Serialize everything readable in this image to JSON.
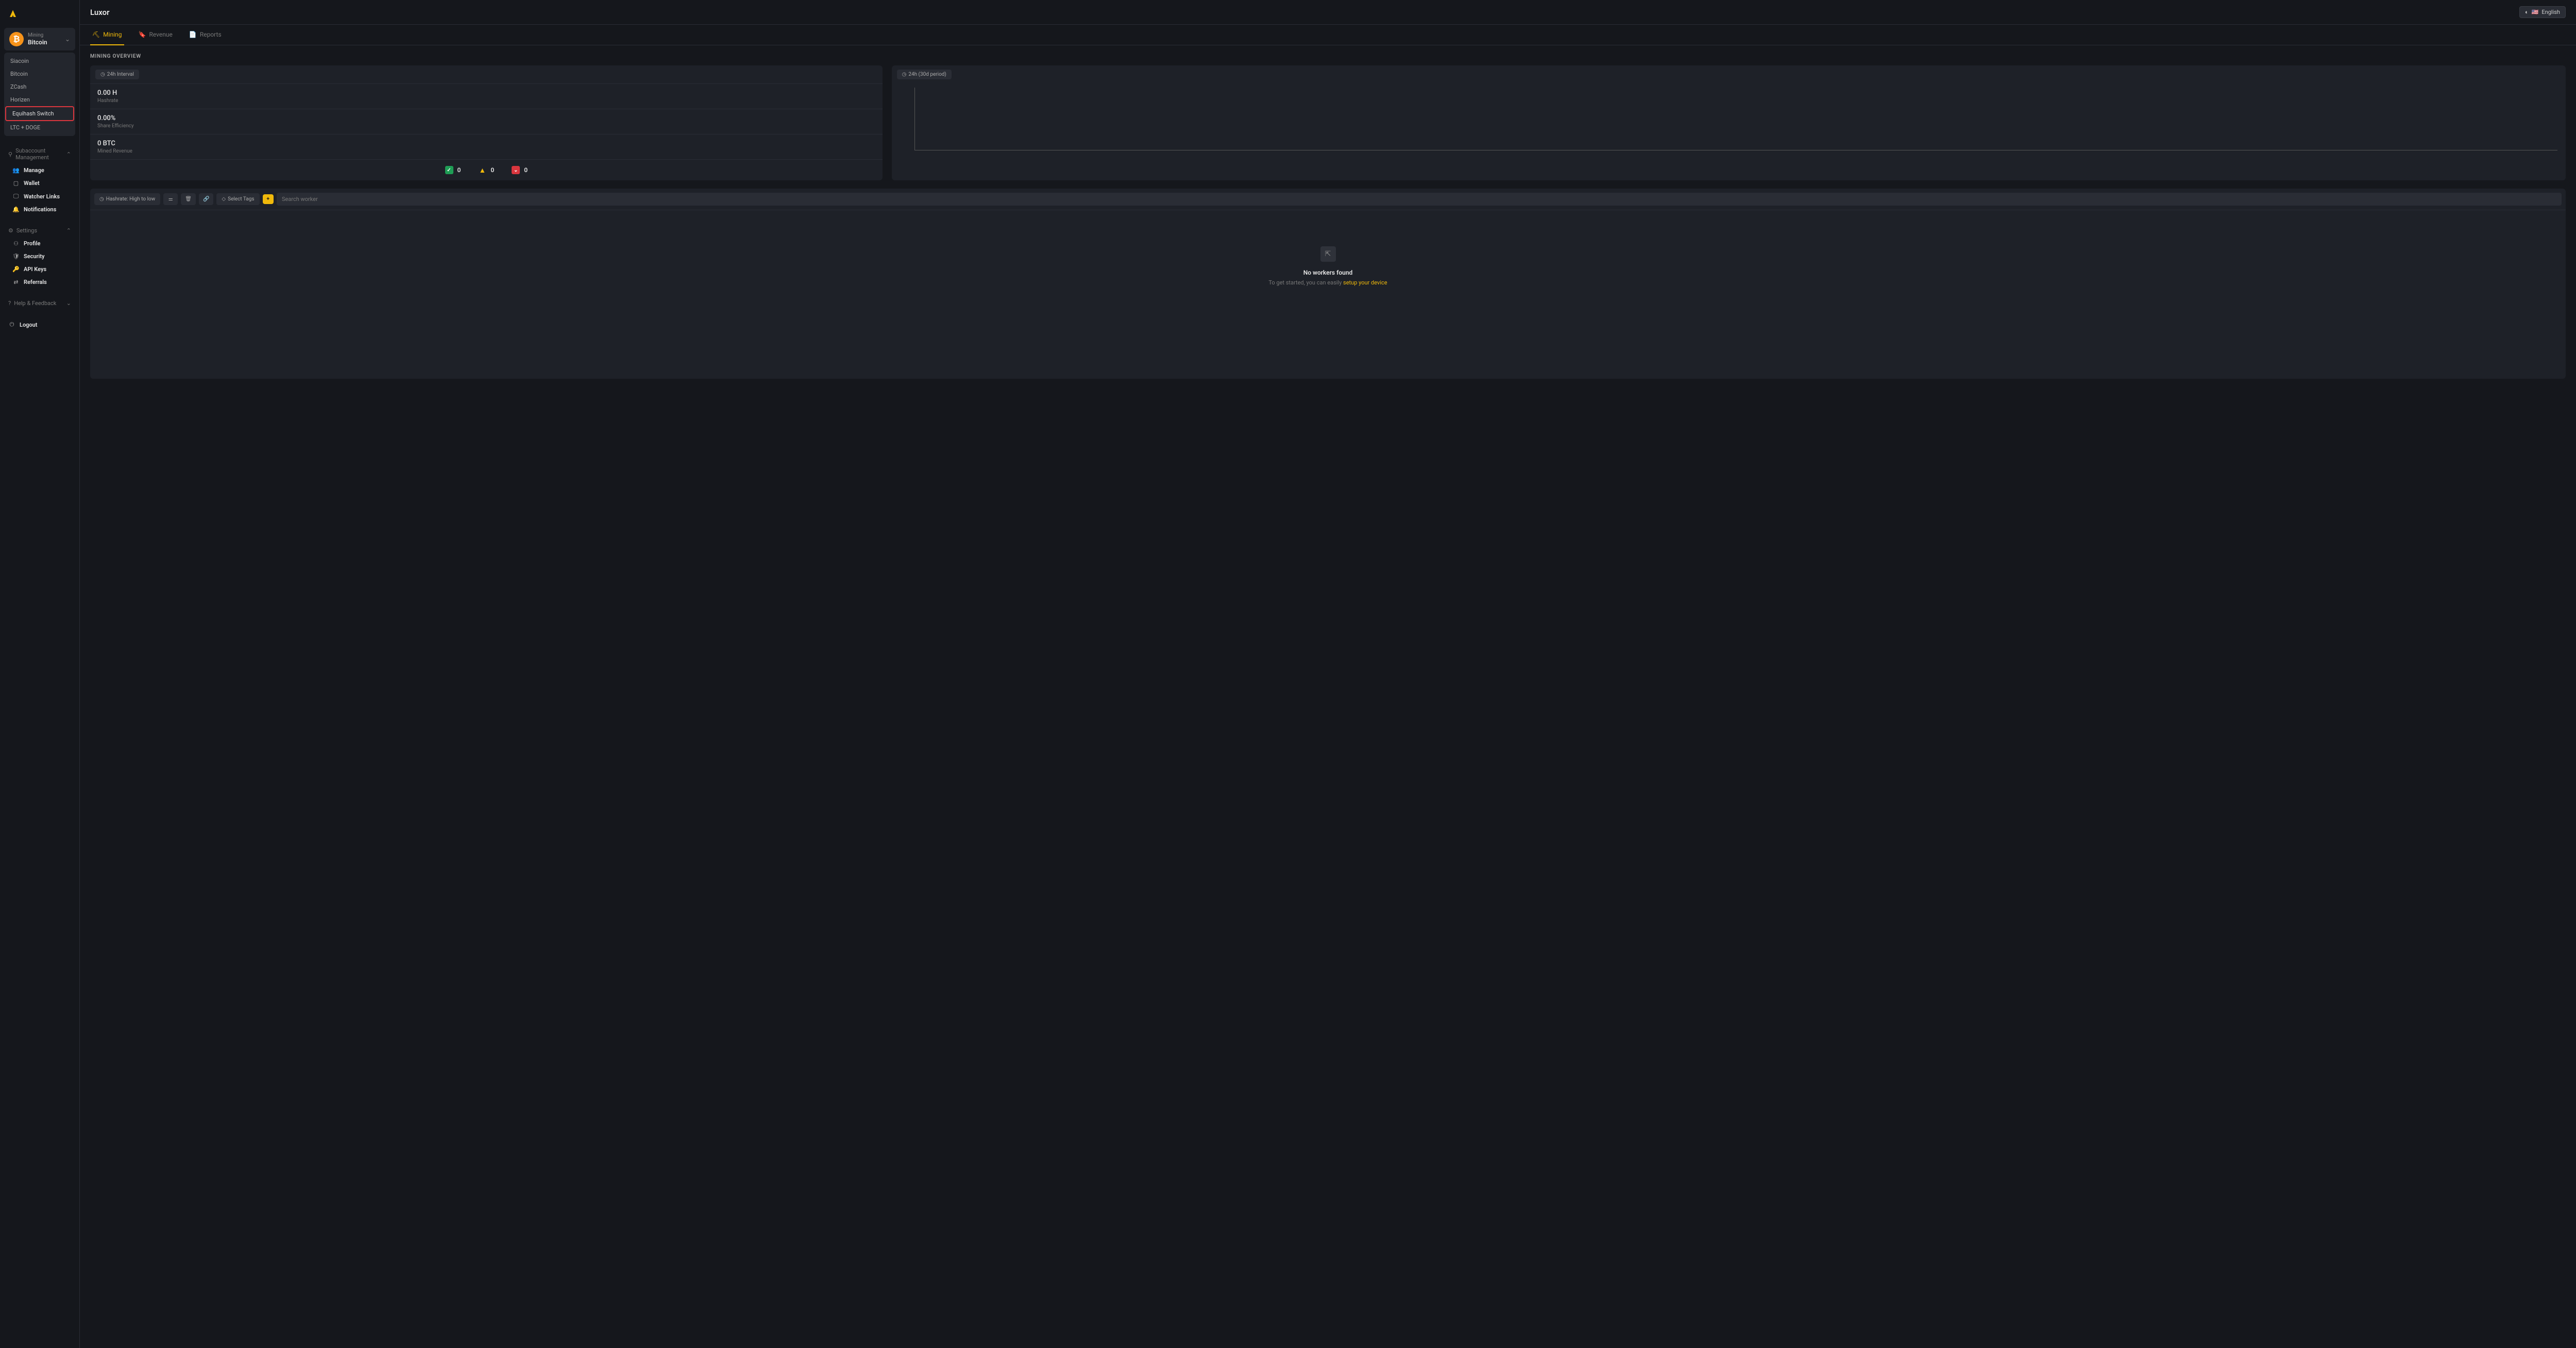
{
  "brand": "Luxor",
  "language": "English",
  "coin_selector": {
    "label": "Mining",
    "value": "Bitcoin"
  },
  "coins": [
    {
      "name": "Siacoin"
    },
    {
      "name": "Bitcoin"
    },
    {
      "name": "ZCash"
    },
    {
      "name": "Horizen"
    },
    {
      "name": "Equihash Switch",
      "highlighted": true
    },
    {
      "name": "LTC + DOGE"
    }
  ],
  "sidebar": {
    "subacct": {
      "title": "Subaccount Management",
      "items": [
        "Manage",
        "Wallet",
        "Watcher Links",
        "Notifications"
      ]
    },
    "settings": {
      "title": "Settings",
      "items": [
        "Profile",
        "Security",
        "API Keys",
        "Referrals"
      ]
    },
    "help": {
      "title": "Help & Feedback"
    },
    "logout": "Logout"
  },
  "tabs": [
    {
      "label": "Mining",
      "active": true
    },
    {
      "label": "Revenue"
    },
    {
      "label": "Reports"
    }
  ],
  "overview": {
    "title": "MINING OVERVIEW",
    "interval_label": "24h Interval",
    "chart_label": "24h (30d period)",
    "metrics": [
      {
        "value": "0.00 H",
        "label": "Hashrate"
      },
      {
        "value": "0.00%",
        "label": "Share Efficiency"
      },
      {
        "value": "0 BTC",
        "label": "Mined Revenue"
      }
    ],
    "status": {
      "ok": "0",
      "warn": "0",
      "err": "0"
    }
  },
  "workers": {
    "sort_label": "Hashrate: High to low",
    "tags_label": "Select Tags",
    "search_placeholder": "Search worker",
    "empty_title": "No workers found",
    "empty_sub_prefix": "To get started, you can easily ",
    "empty_link": "setup your device"
  },
  "chart_data": {
    "type": "line",
    "title": "24h (30d period)",
    "series": [],
    "xlabel": "",
    "ylabel": "",
    "note": "empty chart - axes only"
  }
}
